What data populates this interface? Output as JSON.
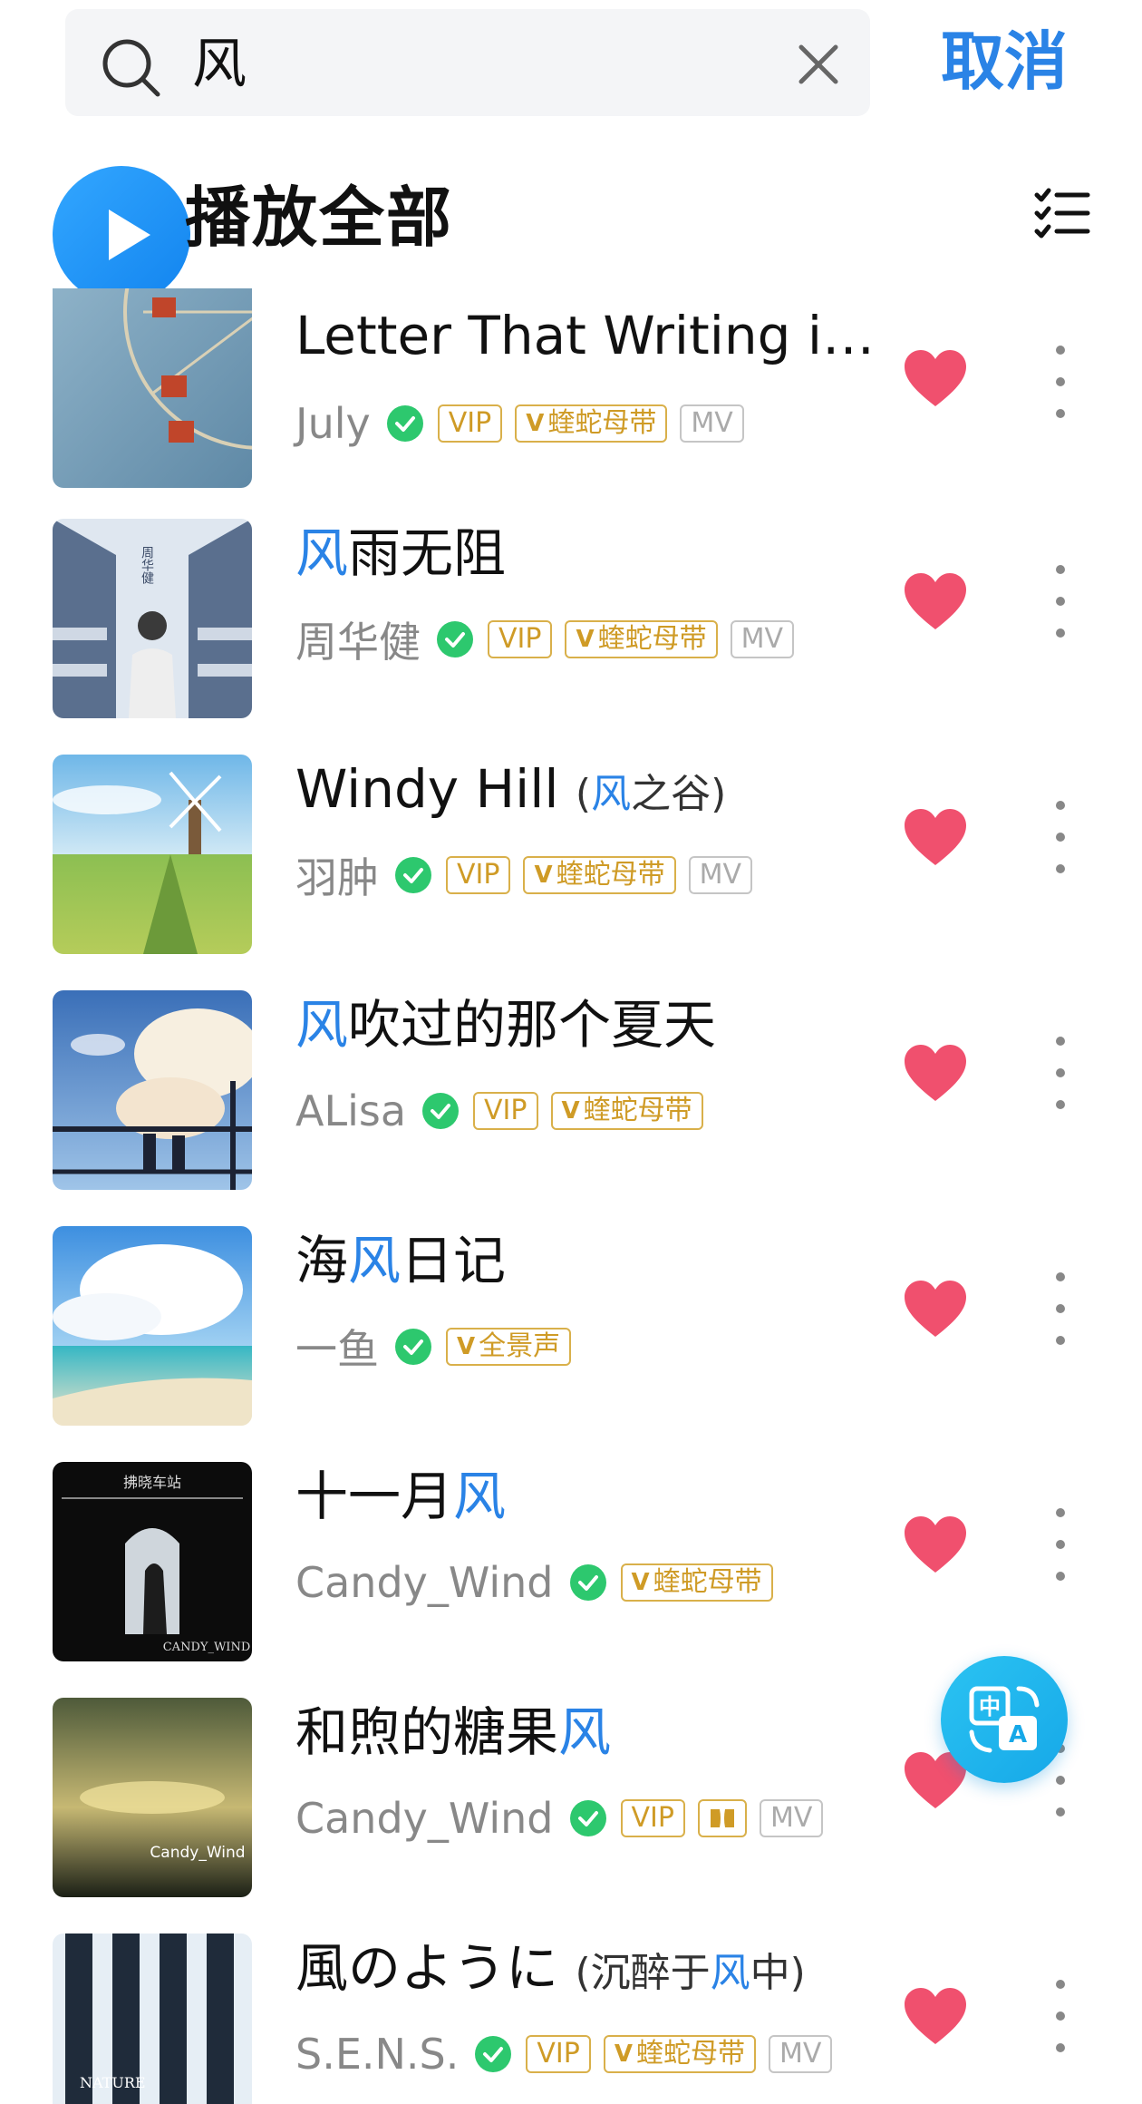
{
  "search": {
    "query": "风",
    "cancel_label": "取消"
  },
  "play_all": {
    "label": "播放全部"
  },
  "colors": {
    "accent": "#2a83e6",
    "heart": "#f0506e",
    "tag": "#cf9b26",
    "verified": "#2dc86e"
  },
  "songs": [
    {
      "title_parts": [
        "Letter That Writing in …",
        "",
        ""
      ],
      "subtitle": "",
      "artist": "July",
      "tags": [
        "VIP",
        "蝰蛇母带",
        "MV"
      ]
    },
    {
      "title_parts": [
        "",
        "风",
        "雨无阻"
      ],
      "subtitle": "",
      "artist": "周华健",
      "tags": [
        "VIP",
        "蝰蛇母带",
        "MV"
      ]
    },
    {
      "title_parts": [
        "Windy Hill",
        "",
        ""
      ],
      "subtitle_parts": [
        "(",
        "风",
        "之谷)"
      ],
      "artist": "羽肿",
      "tags": [
        "VIP",
        "蝰蛇母带",
        "MV"
      ]
    },
    {
      "title_parts": [
        "",
        "风",
        "吹过的那个夏天"
      ],
      "artist": "ALisa",
      "tags": [
        "VIP",
        "蝰蛇母带"
      ]
    },
    {
      "title_parts": [
        "海",
        "风",
        "日记"
      ],
      "artist": "一鱼",
      "tags": [
        "全景声"
      ]
    },
    {
      "title_parts": [
        "十一月",
        "风",
        ""
      ],
      "artist": "Candy_Wind",
      "tags": [
        "蝰蛇母带"
      ]
    },
    {
      "title_parts": [
        "和煦的糖果",
        "风",
        ""
      ],
      "artist": "Candy_Wind",
      "tags": [
        "VIP",
        "dolby",
        "MV"
      ]
    },
    {
      "title_parts": [
        "風のように",
        "",
        ""
      ],
      "subtitle_parts": [
        "(沉醉于",
        "风",
        "中)"
      ],
      "artist": "S.E.N.S.",
      "tags": [
        "VIP",
        "蝰蛇母带",
        "MV"
      ]
    }
  ],
  "cover_text": {
    "s2_a": "周华健",
    "s6_a": "拂晓车站",
    "s6_b": "CANDY_WIND",
    "s7_a": "Candy_Wind",
    "s8_a": "NATURE"
  },
  "icons": {
    "search": "search-icon",
    "clear": "close-icon",
    "play": "play-icon",
    "list": "multi-select-icon",
    "heart": "heart-icon",
    "more": "more-vertical-icon",
    "verified": "verified-check-icon",
    "translate": "translate-icon"
  }
}
